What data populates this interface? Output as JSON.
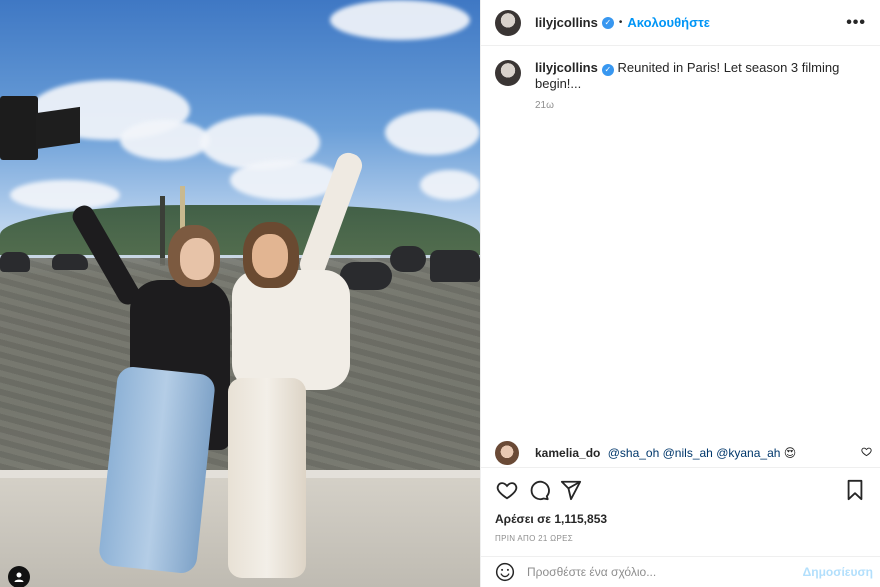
{
  "post": {
    "username": "lilyjcollins",
    "follow_label": "Ακολουθήστε",
    "dot": "•",
    "more_label": "•••"
  },
  "caption": {
    "username": "lilyjcollins",
    "text": "Reunited in Paris! Let season 3 filming begin!...",
    "time": "21ω"
  },
  "comment": {
    "username": "kamelia_do",
    "mentions": [
      "@sha_oh",
      "@nils_ah",
      "@kyana_ah"
    ],
    "emoji": "😍"
  },
  "likes": {
    "text": "Αρέσει σε 1,115,853"
  },
  "posted_ago": "ΠΡΙΝ ΑΠΟ 21 ΩΡΕΣ",
  "add_comment": {
    "placeholder": "Προσθέστε ένα σχόλιο...",
    "publish_label": "Δημοσίευση"
  },
  "icons": {
    "verified": "verified-badge-icon",
    "like": "heart-icon",
    "comment": "comment-bubble-icon",
    "share": "paper-plane-icon",
    "save": "bookmark-icon",
    "emoji": "emoji-icon",
    "tagged_users": "user-tag-icon"
  },
  "colors": {
    "accent": "#0095f6",
    "verified": "#3897f0",
    "publish_disabled": "#b2dffc",
    "muted": "#8e8e8e"
  }
}
